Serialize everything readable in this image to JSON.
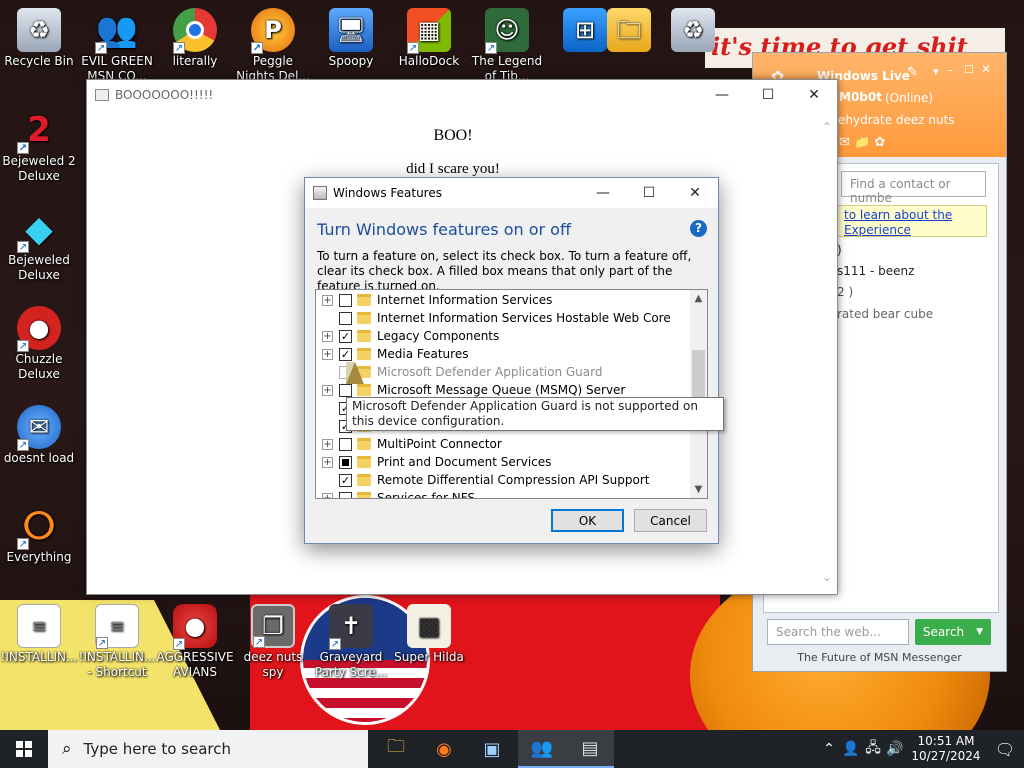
{
  "desktop": {
    "banner_text": "it's time to get shit",
    "icons_left": [
      {
        "label": "Recycle Bin",
        "icon": "recycle-bin-icon"
      },
      {
        "label": "Bejeweled 2 Deluxe",
        "icon": "bejeweled2-icon"
      },
      {
        "label": "Bejeweled Deluxe",
        "icon": "bejeweled-icon"
      },
      {
        "label": "Chuzzle Deluxe",
        "icon": "chuzzle-icon"
      },
      {
        "label": "doesnt load",
        "icon": "thunderbird-icon"
      },
      {
        "label": "Everything",
        "icon": "everything-icon"
      }
    ],
    "icons_top": [
      {
        "label": "EVIL GREEN MSN CO...",
        "icon": "msn-messenger-icon"
      },
      {
        "label": "literally",
        "icon": "chrome-icon"
      },
      {
        "label": "Peggle Nights Del...",
        "icon": "peggle-icon"
      },
      {
        "label": "Spoopy",
        "icon": "network-icon"
      },
      {
        "label": "HalloDock",
        "icon": "hallodock-icon"
      },
      {
        "label": "The Legend of Tib...",
        "icon": "legend-icon"
      }
    ],
    "icons_bottom": [
      {
        "label": "!INSTALLIN...",
        "icon": "text-file-icon"
      },
      {
        "label": "!INSTALLIN... - Shortcut",
        "icon": "text-file-shortcut-icon"
      },
      {
        "label": "AGGRESSIVE AVIANS",
        "icon": "angry-bird-icon"
      },
      {
        "label": "deez nuts spy",
        "icon": "windows-stack-icon"
      },
      {
        "label": "Graveyard Party Scre...",
        "icon": "graveyard-icon"
      },
      {
        "label": "Super Hilda",
        "icon": "super-hilda-icon"
      }
    ]
  },
  "boo_window": {
    "title": "BOOOOOOO!!!!!",
    "heading": "BOO!",
    "subtext": "did I scare you!"
  },
  "msn": {
    "title": "Windows Live",
    "username": "M0b0t",
    "status": "(Online)",
    "personal_message": "ehydrate deez nuts",
    "search_placeholder": "Find a contact or numbe",
    "notice_line1": "to learn about the",
    "notice_line2": "Experience",
    "contacts": [
      {
        "text": ")"
      },
      {
        "text": "s111 - beenz"
      },
      {
        "text": "2 )"
      },
      {
        "text": "rated bear cube"
      }
    ],
    "web_search_placeholder": "Search the web...",
    "web_search_button": "Search",
    "footer": "The Future of MSN Messenger"
  },
  "features_dialog": {
    "title": "Windows Features",
    "heading": "Turn Windows features on or off",
    "help_glyph": "?",
    "description": "To turn a feature on, select its check box. To turn a feature off, clear its check box. A filled box means that only part of the feature is turned on.",
    "features": [
      {
        "name": "Internet Information Services",
        "expandable": true,
        "state": "unchecked",
        "disabled": false
      },
      {
        "name": "Internet Information Services Hostable Web Core",
        "expandable": false,
        "state": "unchecked",
        "disabled": false
      },
      {
        "name": "Legacy Components",
        "expandable": true,
        "state": "checked",
        "disabled": false
      },
      {
        "name": "Media Features",
        "expandable": true,
        "state": "checked",
        "disabled": false
      },
      {
        "name": "Microsoft Defender Application Guard",
        "expandable": false,
        "state": "unchecked",
        "disabled": true
      },
      {
        "name": "Microsoft Message Queue (MSMQ) Server",
        "expandable": true,
        "state": "unchecked",
        "disabled": false
      },
      {
        "name": "",
        "expandable": false,
        "state": "checked",
        "disabled": false
      },
      {
        "name": "",
        "expandable": false,
        "state": "checked",
        "disabled": false
      },
      {
        "name": "MultiPoint Connector",
        "expandable": true,
        "state": "unchecked",
        "disabled": false
      },
      {
        "name": "Print and Document Services",
        "expandable": true,
        "state": "partial",
        "disabled": false
      },
      {
        "name": "Remote Differential Compression API Support",
        "expandable": false,
        "state": "checked",
        "disabled": false
      },
      {
        "name": "Services for NFS",
        "expandable": true,
        "state": "unchecked",
        "disabled": false
      }
    ],
    "tooltip": "Microsoft Defender Application Guard is not supported on this device configuration.",
    "ok_label": "OK",
    "cancel_label": "Cancel"
  },
  "taskbar": {
    "search_placeholder": "Type here to search",
    "apps": [
      {
        "icon": "file-explorer-icon"
      },
      {
        "icon": "firefox-icon"
      },
      {
        "icon": "app-window-icon"
      },
      {
        "icon": "msn-messenger-icon"
      },
      {
        "icon": "file-archive-icon"
      }
    ],
    "time": "10:51 AM",
    "date": "10/27/2024"
  }
}
